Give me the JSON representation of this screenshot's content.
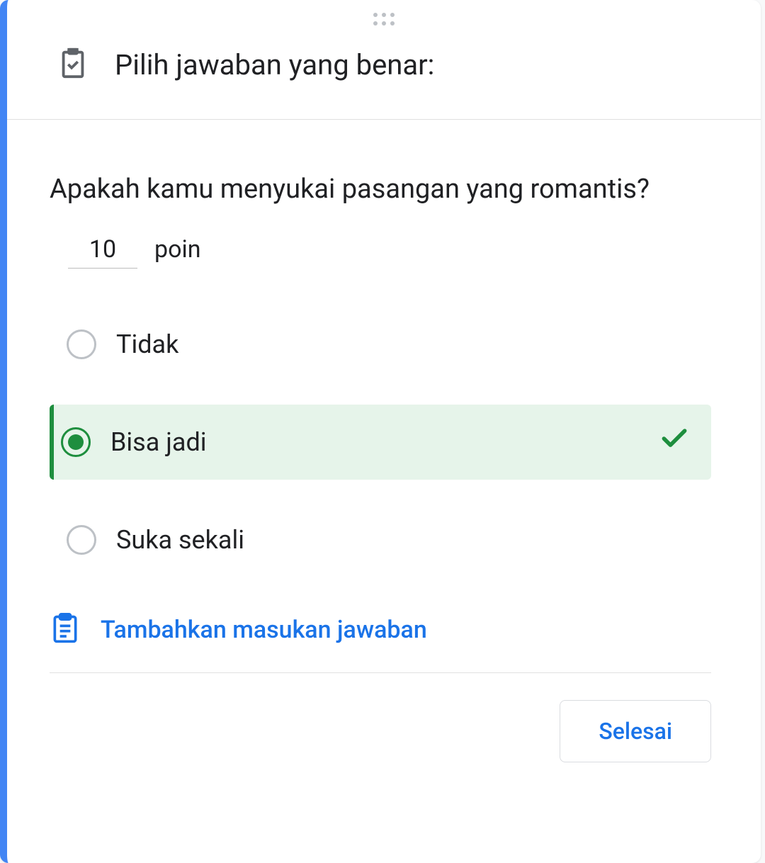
{
  "header": {
    "title": "Pilih jawaban yang benar:"
  },
  "question": {
    "text": "Apakah kamu menyukai pasangan yang romantis?",
    "points_value": "10",
    "points_label": "poin"
  },
  "options": [
    {
      "label": "Tidak",
      "selected": false
    },
    {
      "label": "Bisa jadi",
      "selected": true
    },
    {
      "label": "Suka sekali",
      "selected": false
    }
  ],
  "feedback": {
    "label": "Tambahkan masukan jawaban"
  },
  "footer": {
    "done_label": "Selesai"
  }
}
